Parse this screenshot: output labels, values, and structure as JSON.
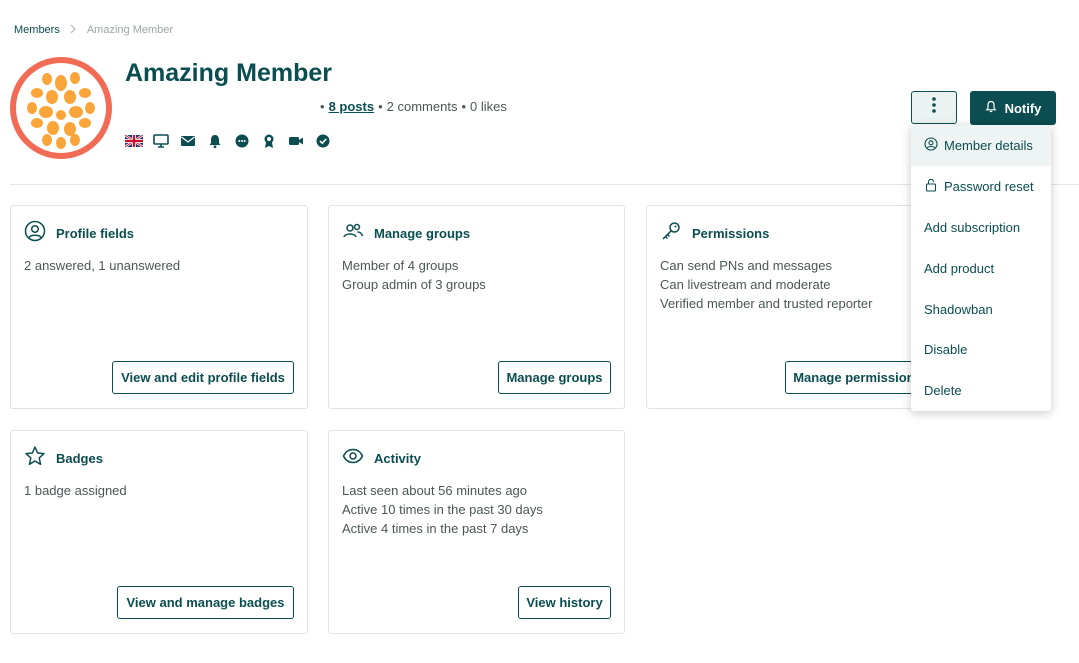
{
  "breadcrumb": {
    "parent": "Members",
    "separator": ">",
    "current": "Amazing Member"
  },
  "header": {
    "title": "Amazing Member",
    "stats": {
      "bullet": "•",
      "posts": "8 posts",
      "comments": "2 comments",
      "likes": "0 likes"
    },
    "status_icons": [
      "uk-flag-icon",
      "desktop-icon",
      "mail-icon",
      "bell-icon",
      "chat-icon",
      "award-icon",
      "video-icon",
      "verified-check-icon"
    ]
  },
  "actions": {
    "more_icon": "kebab-vertical-icon",
    "notify_label": "Notify"
  },
  "menu": {
    "items": [
      {
        "label": "Member details",
        "icon": "user-circle-icon"
      },
      {
        "label": "Password reset",
        "icon": "lock-icon"
      },
      {
        "label": "Add subscription"
      },
      {
        "label": "Add product"
      },
      {
        "label": "Shadowban"
      },
      {
        "label": "Disable"
      },
      {
        "label": "Delete"
      }
    ]
  },
  "cards": {
    "profile": {
      "title": "Profile fields",
      "icon": "user-circle-icon",
      "lines": [
        "2 answered, 1 unanswered"
      ],
      "button": "View and edit profile fields"
    },
    "groups": {
      "title": "Manage groups",
      "icon": "users-icon",
      "lines": [
        "Member of 4 groups",
        "Group admin of 3 groups"
      ],
      "button": "Manage groups"
    },
    "permissions": {
      "title": "Permissions",
      "icon": "key-icon",
      "lines": [
        "Can send PNs and messages",
        "Can livestream and moderate",
        "Verified member and trusted reporter"
      ],
      "button": "Manage permissions"
    },
    "badges": {
      "title": "Badges",
      "icon": "star-icon",
      "lines": [
        "1 badge assigned"
      ],
      "button": "View and manage badges"
    },
    "activity": {
      "title": "Activity",
      "icon": "eye-icon",
      "lines": [
        "Last seen about 56 minutes ago",
        "Active 10 times in the past 30 days",
        "Active 4 times in the past 7 days"
      ],
      "button": "View history"
    }
  },
  "colors": {
    "brand": "#0b4d50",
    "avatar_bg": "#f26b55",
    "avatar_dots": "#f9a53a"
  }
}
